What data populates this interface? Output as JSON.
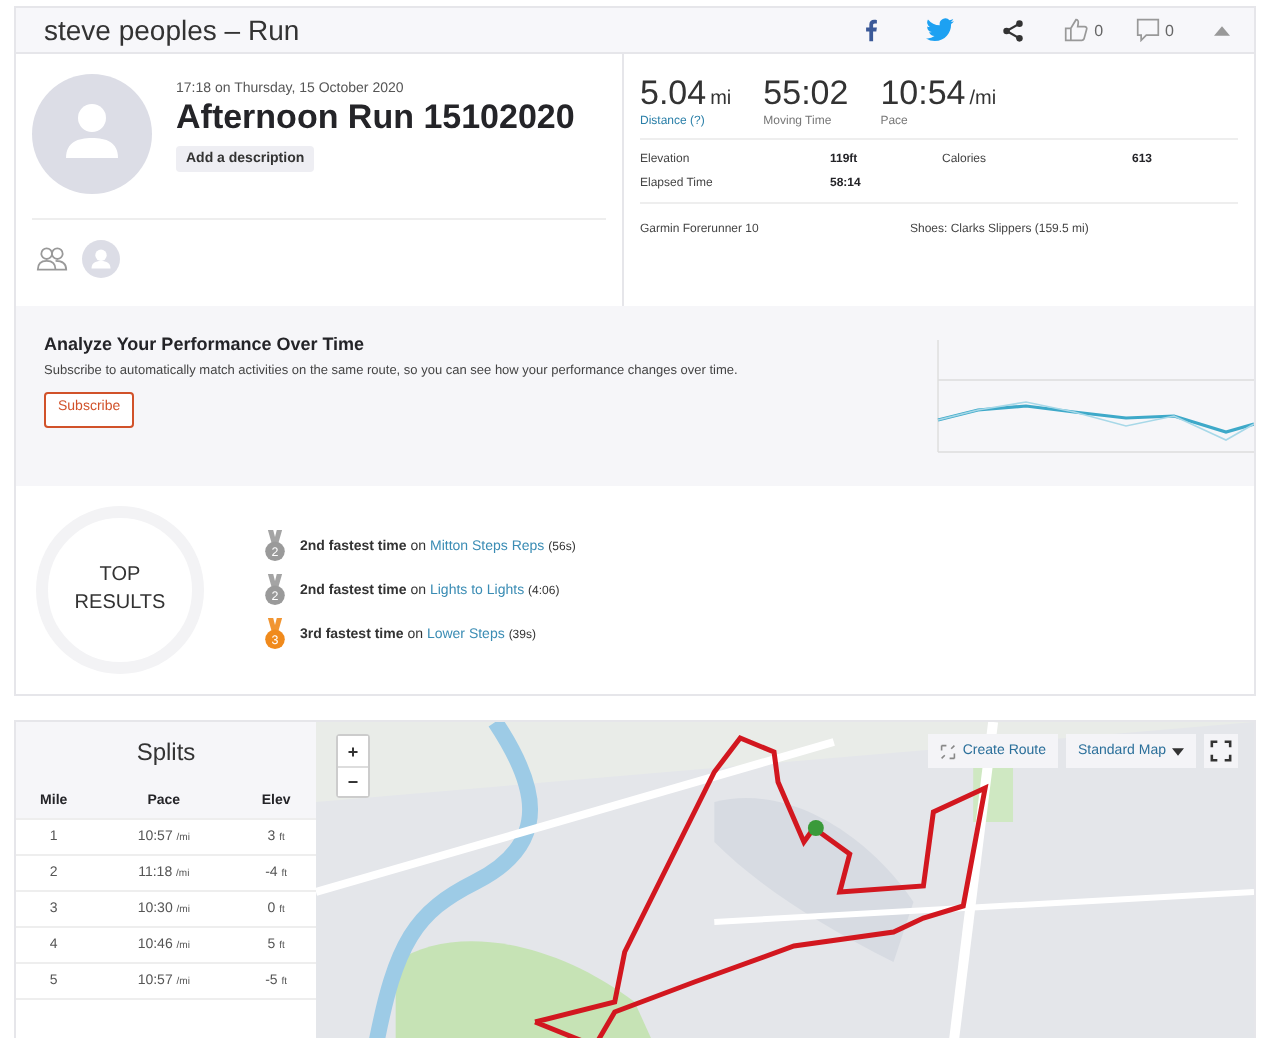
{
  "header": {
    "title": "steve peoples – Run",
    "kudos_count": "0",
    "comment_count": "0"
  },
  "activity": {
    "datetime": "17:18 on Thursday, 15 October 2020",
    "name": "Afternoon Run 15102020",
    "description_button": "Add a description"
  },
  "stats": {
    "primary": [
      {
        "value": "5.04",
        "unit": "mi",
        "label": "Distance (?)",
        "kind": "link"
      },
      {
        "value": "55:02",
        "label": "Moving Time",
        "kind": "plain"
      },
      {
        "value": "10:54",
        "unit": "/mi",
        "label": "Pace",
        "kind": "plain"
      }
    ],
    "secondary": [
      {
        "label": "Elevation",
        "value": "119ft"
      },
      {
        "label": "Calories",
        "value": "613"
      },
      {
        "label": "Elapsed Time",
        "value": "58:14"
      }
    ],
    "device": "Garmin Forerunner 10",
    "shoes": "Shoes: Clarks Slippers (159.5 mi)"
  },
  "analyze": {
    "title": "Analyze Your Performance Over Time",
    "text": "Subscribe to automatically match activities on the same route, so you can see how your performance changes over time.",
    "button": "Subscribe"
  },
  "top_results": {
    "badge_lines": [
      "TOP",
      "RESULTS"
    ],
    "items": [
      {
        "kind": "silver",
        "rank": "2",
        "achievement": "2nd fastest time",
        "on": "on",
        "segment": "Mitton Steps Reps",
        "time": "(56s)"
      },
      {
        "kind": "silver",
        "rank": "2",
        "achievement": "2nd fastest time",
        "on": "on",
        "segment": "Lights to Lights",
        "time": "(4:06)"
      },
      {
        "kind": "bronze",
        "rank": "3",
        "achievement": "3rd fastest time",
        "on": "on",
        "segment": "Lower Steps",
        "time": "(39s)"
      }
    ]
  },
  "splits": {
    "title": "Splits",
    "columns": [
      "Mile",
      "Pace",
      "Elev"
    ],
    "rows": [
      {
        "mile": "1",
        "pace": "10:57",
        "pace_unit": "/mi",
        "elev": "3",
        "elev_unit": "ft"
      },
      {
        "mile": "2",
        "pace": "11:18",
        "pace_unit": "/mi",
        "elev": "-4",
        "elev_unit": "ft"
      },
      {
        "mile": "3",
        "pace": "10:30",
        "pace_unit": "/mi",
        "elev": "0",
        "elev_unit": "ft"
      },
      {
        "mile": "4",
        "pace": "10:46",
        "pace_unit": "/mi",
        "elev": "5",
        "elev_unit": "ft"
      },
      {
        "mile": "5",
        "pace": "10:57",
        "pace_unit": "/mi",
        "elev": "-5",
        "elev_unit": "ft"
      }
    ]
  },
  "map": {
    "zoom_in": "+",
    "zoom_out": "−",
    "create_route": "Create Route",
    "map_type": "Standard Map"
  }
}
